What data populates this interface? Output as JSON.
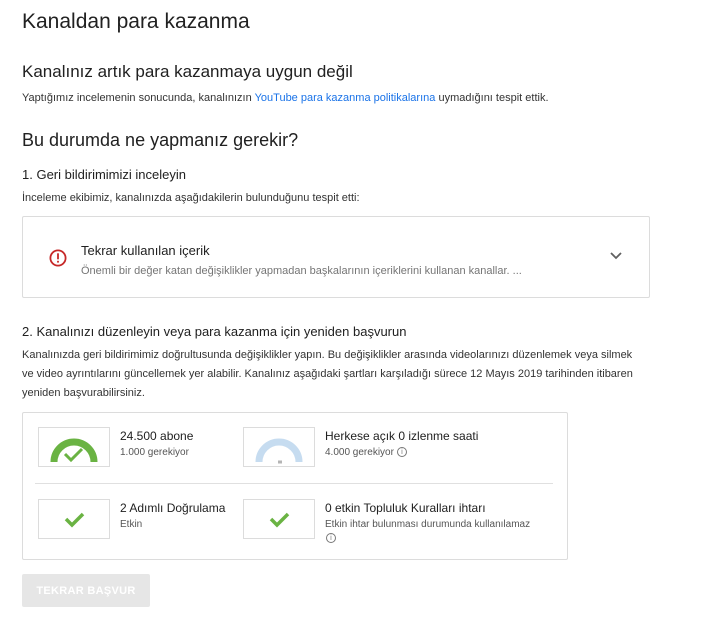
{
  "page": {
    "title": "Kanaldan para kazanma"
  },
  "status": {
    "heading": "Kanalınız artık para kazanmaya uygun değil",
    "desc_before": "Yaptığımız incelemenin sonucunda, kanalınızın ",
    "policy_link": "YouTube para kazanma politikalarına",
    "desc_after": " uymadığını tespit ettik."
  },
  "what_to_do": {
    "heading": "Bu durumda ne yapmanız gerekir?"
  },
  "step1": {
    "title": "1. Geri bildirimimizi inceleyin",
    "desc": "İnceleme ekibimiz, kanalınızda aşağıdakilerin bulunduğunu tespit etti:",
    "issue": {
      "title": "Tekrar kullanılan içerik",
      "subtitle": "Önemli bir değer katan değişiklikler yapmadan başkalarının içeriklerini kullanan kanallar. ...",
      "icon": "error-icon",
      "icon_color": "#c62828"
    }
  },
  "step2": {
    "title": "2. Kanalınızı düzenleyin veya para kazanma için yeniden başvurun",
    "desc": "Kanalınızda geri bildirimimiz doğrultusunda değişiklikler yapın. Bu değişiklikler arasında videolarınızı düzenlemek veya silmek ve video ayrıntılarını güncellemek yer alabilir. Kanalınız aşağıdaki şartları karşıladığı sürece 12 Mayıs 2019 tarihinden itibaren yeniden başvurabilirsiniz."
  },
  "requirements": [
    {
      "title": "24.500 abone",
      "subtitle": "1.000 gerekiyor",
      "progress": 1.0,
      "met": true,
      "icon": "gauge-check-icon",
      "color": "#6ab343"
    },
    {
      "title": "Herkese açık 0 izlenme saati",
      "subtitle": "4.000 gerekiyor",
      "progress": 0.0,
      "met": false,
      "icon": "gauge-icon",
      "color": "#c6dcf0",
      "has_info": true
    },
    {
      "title": "2 Adımlı Doğrulama",
      "subtitle": "Etkin",
      "met": true,
      "icon": "check-icon",
      "color": "#6ab343"
    },
    {
      "title": "0 etkin Topluluk Kuralları ihtarı",
      "subtitle": "Etkin ihtar bulunması durumunda kullanılamaz",
      "met": true,
      "icon": "check-icon",
      "color": "#6ab343",
      "has_info": true
    }
  ],
  "actions": {
    "reapply_label": "TEKRAR BAŞVUR"
  }
}
